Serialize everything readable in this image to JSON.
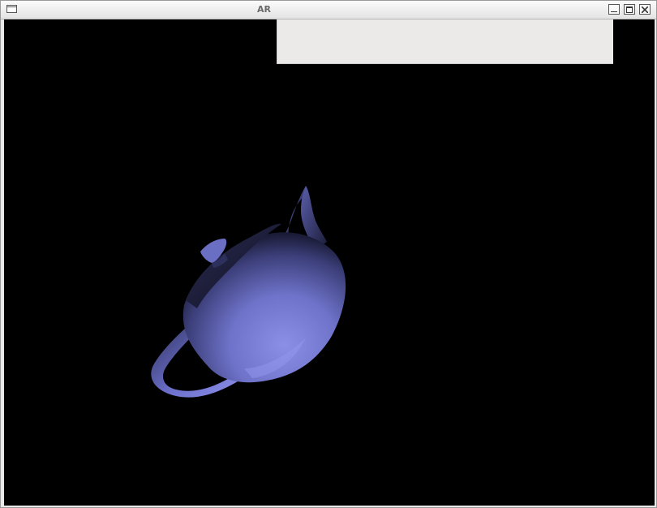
{
  "window": {
    "title": "AR"
  },
  "icons": {
    "menu": "window-menu-icon",
    "minimize": "minimize-icon",
    "maximize": "maximize-icon",
    "close": "close-icon",
    "scene": "teapot-icon"
  },
  "colors": {
    "viewport_background": "#000000",
    "teapot_base": "#7c80d8",
    "teapot_shadow": "#1a1b33"
  }
}
